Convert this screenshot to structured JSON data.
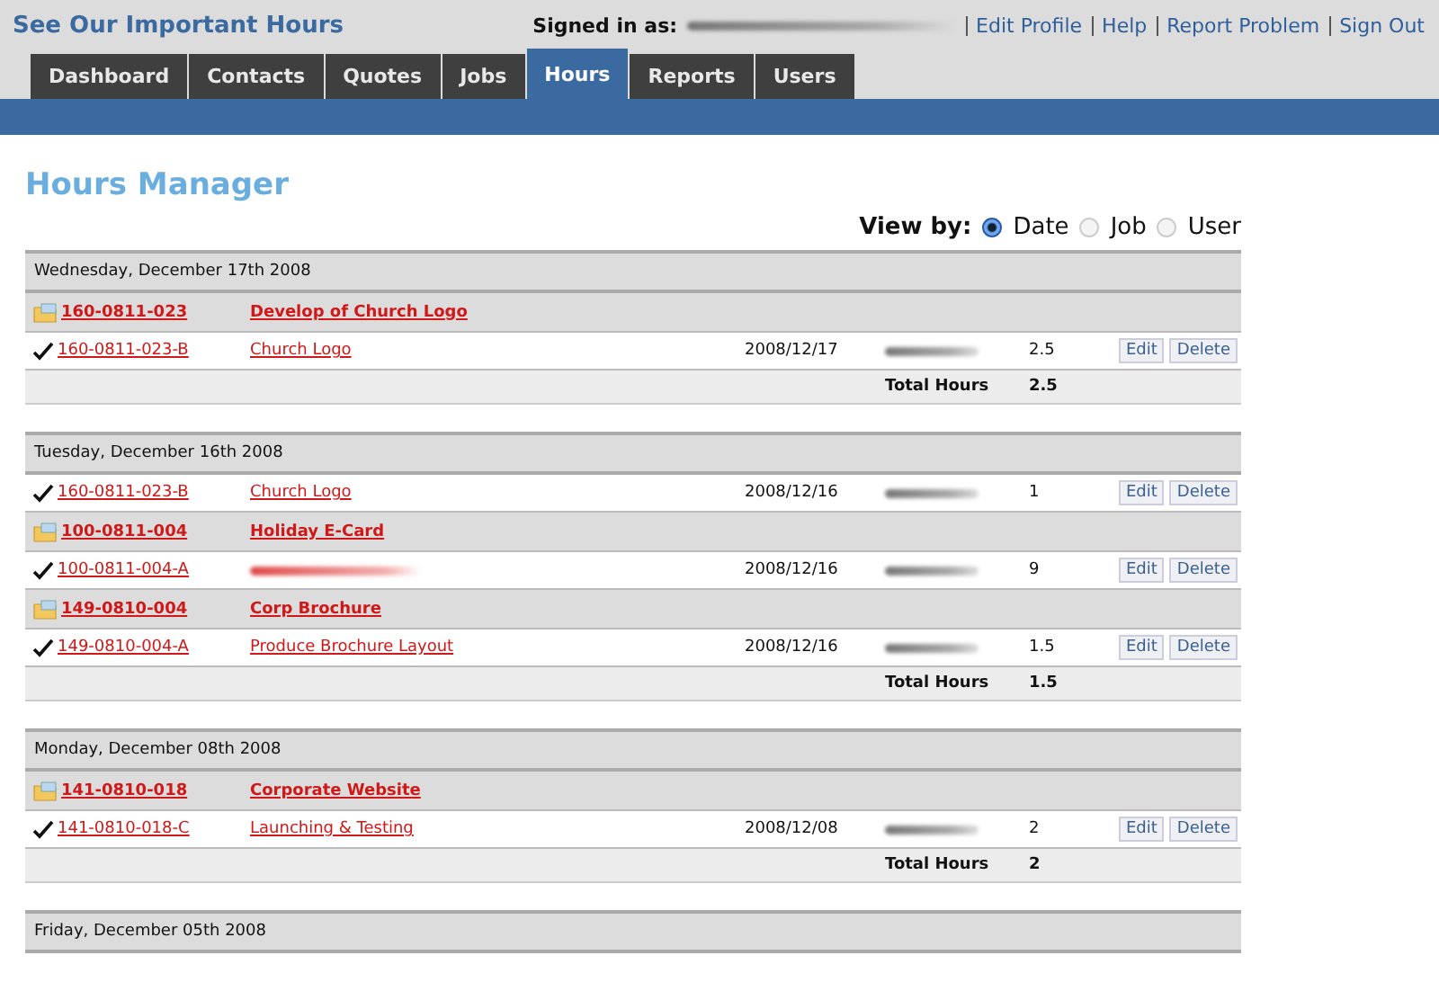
{
  "header": {
    "title": "See Our Important Hours",
    "signed_in_label": "Signed in as:",
    "links": [
      "Edit Profile",
      "Help",
      "Report Problem",
      "Sign Out"
    ]
  },
  "tabs": [
    {
      "label": "Dashboard",
      "selected": false
    },
    {
      "label": "Contacts",
      "selected": false
    },
    {
      "label": "Quotes",
      "selected": false
    },
    {
      "label": "Jobs",
      "selected": false
    },
    {
      "label": "Hours",
      "selected": true
    },
    {
      "label": "Reports",
      "selected": false
    },
    {
      "label": "Users",
      "selected": false
    }
  ],
  "page_title": "Hours Manager",
  "view_by": {
    "label": "View by:",
    "options": [
      {
        "label": "Date",
        "selected": true
      },
      {
        "label": "Job",
        "selected": false
      },
      {
        "label": "User",
        "selected": false
      }
    ]
  },
  "sections": [
    {
      "date": "Wednesday, December 17th 2008",
      "rows": [
        {
          "kind": "job",
          "code": "160-0811-023",
          "name": "Develop of Church Logo"
        },
        {
          "kind": "task",
          "code": "160-0811-023-B",
          "name": "Church Logo",
          "date": "2008/12/17",
          "hours": "2.5",
          "actions": [
            "Edit",
            "Delete"
          ]
        }
      ],
      "total_label": "Total Hours",
      "total": "2.5"
    },
    {
      "date": "Tuesday, December 16th 2008",
      "rows": [
        {
          "kind": "task",
          "code": "160-0811-023-B",
          "name": "Church Logo",
          "date": "2008/12/16",
          "hours": "1",
          "actions": [
            "Edit",
            "Delete"
          ]
        },
        {
          "kind": "job",
          "code": "100-0811-004",
          "name": "Holiday E-Card"
        },
        {
          "kind": "task",
          "code": "100-0811-004-A",
          "date": "2008/12/16",
          "hours": "9",
          "actions": [
            "Edit",
            "Delete"
          ]
        },
        {
          "kind": "job",
          "code": "149-0810-004",
          "name": "Corp Brochure"
        },
        {
          "kind": "task",
          "code": "149-0810-004-A",
          "name": "Produce Brochure Layout",
          "date": "2008/12/16",
          "hours": "1.5",
          "actions": [
            "Edit",
            "Delete"
          ]
        }
      ],
      "total_label": "Total Hours",
      "total": "1.5"
    },
    {
      "date": "Monday, December 08th 2008",
      "rows": [
        {
          "kind": "job",
          "code": "141-0810-018",
          "name": "Corporate Website"
        },
        {
          "kind": "task",
          "code": "141-0810-018-C",
          "name": "Launching & Testing",
          "date": "2008/12/08",
          "hours": "2",
          "actions": [
            "Edit",
            "Delete"
          ]
        }
      ],
      "total_label": "Total Hours",
      "total": "2"
    },
    {
      "date": "Friday, December 05th 2008"
    }
  ]
}
